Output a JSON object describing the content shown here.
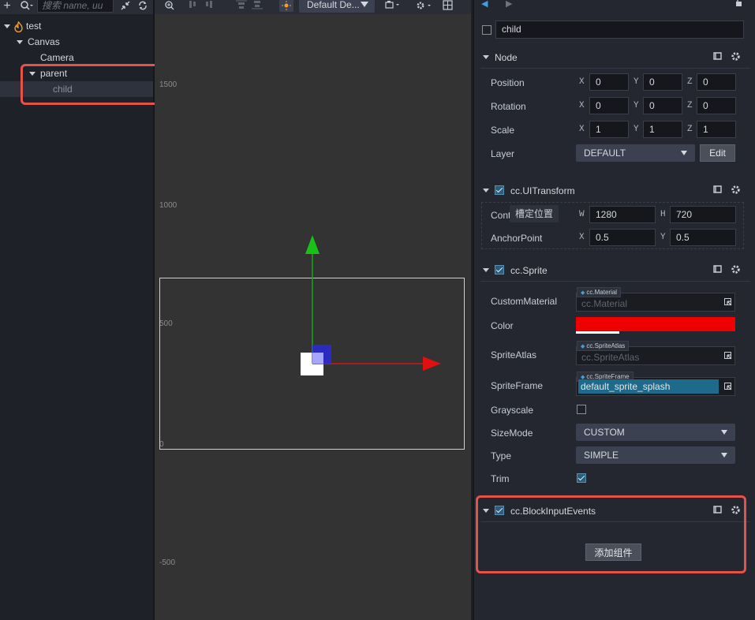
{
  "hierarchy": {
    "search_placeholder": "搜索 name, uu",
    "tree": [
      {
        "label": "test"
      },
      {
        "label": "Canvas"
      },
      {
        "label": "Camera"
      },
      {
        "label": "parent"
      },
      {
        "label": "child"
      }
    ]
  },
  "scene": {
    "design_resolution": "Default De...",
    "scale_labels": [
      "1500",
      "1000",
      "500",
      "0",
      "-500"
    ]
  },
  "inspector": {
    "node_name": "child",
    "node_section": {
      "title": "Node",
      "position": {
        "label": "Position",
        "x": "0",
        "y": "0",
        "z": "0"
      },
      "rotation": {
        "label": "Rotation",
        "x": "0",
        "y": "0",
        "z": "0"
      },
      "scale": {
        "label": "Scale",
        "x": "1",
        "y": "1",
        "z": "1"
      },
      "layer": {
        "label": "Layer",
        "value": "DEFAULT",
        "edit_label": "Edit"
      }
    },
    "uitransform": {
      "title": "cc.UITransform",
      "content_size": {
        "label": "Conte",
        "w": "1280",
        "h": "720"
      },
      "tooltip": "槽定位置",
      "anchor": {
        "label": "AnchorPoint",
        "x": "0.5",
        "y": "0.5"
      }
    },
    "sprite": {
      "title": "cc.Sprite",
      "custom_material": {
        "label": "CustomMaterial",
        "tag": "cc.Material",
        "value": "cc.Material"
      },
      "color": {
        "label": "Color",
        "value": "#ee0000"
      },
      "sprite_atlas": {
        "label": "SpriteAtlas",
        "tag": "cc.SpriteAtlas",
        "value": "cc.SpriteAtlas"
      },
      "sprite_frame": {
        "label": "SpriteFrame",
        "tag": "cc.SpriteFrame",
        "value": "default_sprite_splash"
      },
      "grayscale": {
        "label": "Grayscale"
      },
      "size_mode": {
        "label": "SizeMode",
        "value": "CUSTOM"
      },
      "type": {
        "label": "Type",
        "value": "SIMPLE"
      },
      "trim": {
        "label": "Trim"
      }
    },
    "block_input": {
      "title": "cc.BlockInputEvents"
    },
    "add_component_label": "添加组件"
  },
  "colors": {
    "highlight_border": "#e5524c",
    "sprite_color": "#ee0000",
    "selected_asset_bg": "#1d6a8a"
  }
}
